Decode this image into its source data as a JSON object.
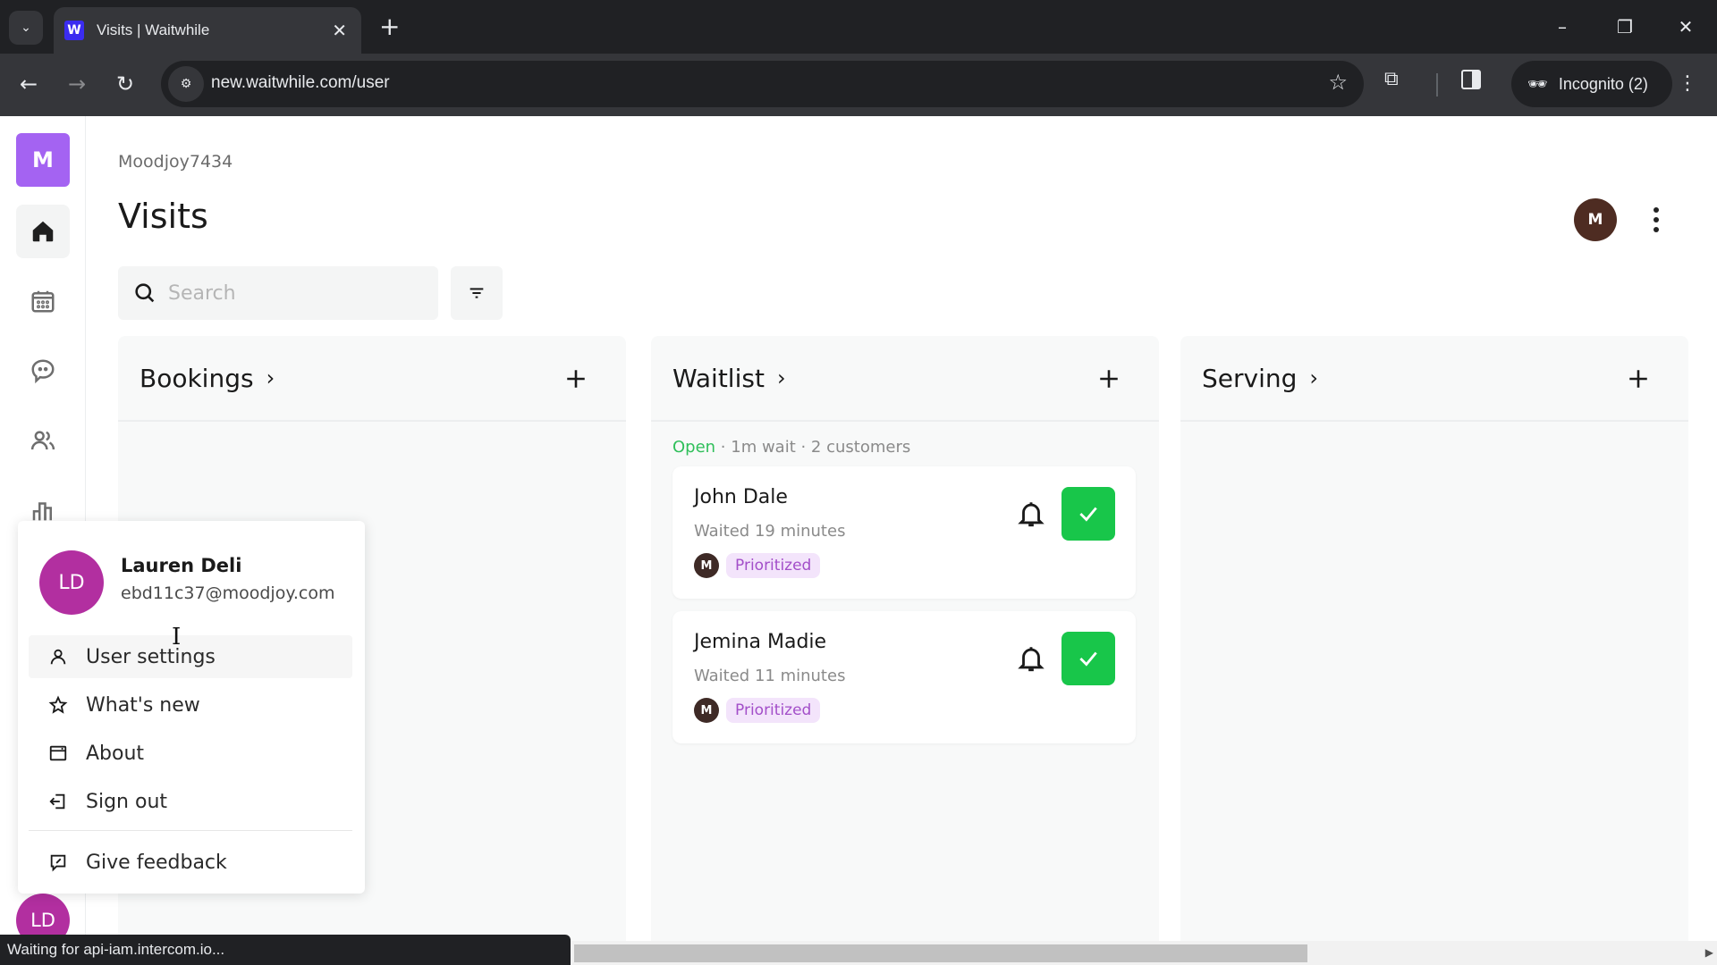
{
  "browser": {
    "tab_title": "Visits | Waitwhile",
    "favicon_letter": "W",
    "url": "new.waitwhile.com/user",
    "incognito_label": "Incognito (2)",
    "window_controls": {
      "minimize": "–",
      "restore": "❐",
      "close": "✕"
    },
    "status_text": "Waiting for api-iam.intercom.io..."
  },
  "sidebar": {
    "org_initial": "M",
    "org_color": "#a463f2",
    "items": [
      {
        "name": "home",
        "icon": "home-icon",
        "active": true
      },
      {
        "name": "calendar",
        "icon": "calendar-icon",
        "active": false
      },
      {
        "name": "messages",
        "icon": "chat-icon",
        "active": false
      },
      {
        "name": "customers",
        "icon": "users-icon",
        "active": false
      },
      {
        "name": "analytics",
        "icon": "bar-chart-icon",
        "active": false
      }
    ],
    "user_initials": "LD",
    "user_color": "#b22fa0"
  },
  "header": {
    "workspace": "Moodjoy7434",
    "title": "Visits",
    "avatar_initial": "M",
    "avatar_color": "#4e2c22"
  },
  "search": {
    "placeholder": "Search",
    "value": ""
  },
  "columns": [
    {
      "title": "Bookings",
      "chevron": "›",
      "add": "+"
    },
    {
      "title": "Waitlist",
      "chevron": "›",
      "add": "+",
      "status": {
        "state": "Open",
        "detail": " · 1m wait · 2 customers"
      },
      "cards": [
        {
          "name": "John Dale",
          "waited": "Waited 19 minutes",
          "tag_avatar": "M",
          "tag": "Prioritized"
        },
        {
          "name": "Jemina Madie",
          "waited": "Waited 11 minutes",
          "tag_avatar": "M",
          "tag": "Prioritized"
        }
      ]
    },
    {
      "title": "Serving",
      "chevron": "›",
      "add": "+"
    }
  ],
  "user_menu": {
    "initials": "LD",
    "name": "Lauren Deli",
    "email": "ebd11c37@moodjoy.com",
    "items": [
      {
        "label": "User settings",
        "icon": "user-icon"
      },
      {
        "label": "What's new",
        "icon": "star-icon"
      },
      {
        "label": "About",
        "icon": "window-icon"
      },
      {
        "label": "Sign out",
        "icon": "sign-out-icon"
      },
      {
        "label": "Give feedback",
        "icon": "feedback-icon"
      }
    ]
  },
  "colors": {
    "accent_green": "#18c64a",
    "open_green": "#2fbf5a",
    "tag_bg": "#f3e4fb",
    "tag_text": "#a34fc9"
  }
}
